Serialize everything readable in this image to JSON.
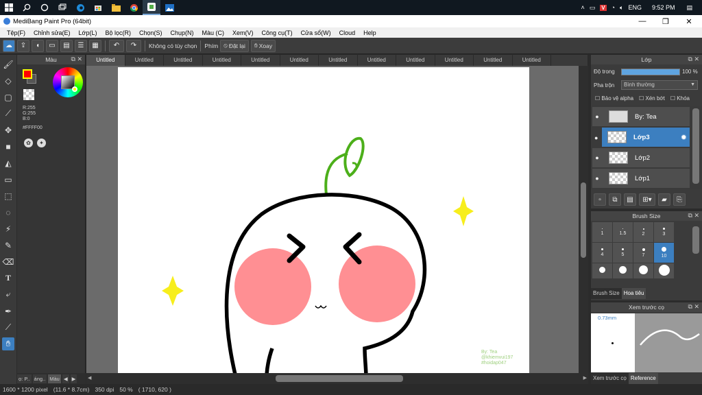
{
  "taskbar": {
    "icons": [
      "windows-icon",
      "search-icon",
      "cortana-icon",
      "task-view-icon",
      "edge-icon",
      "store-icon",
      "explorer-icon",
      "chrome-icon",
      "medibang-icon",
      "photos-icon"
    ],
    "tray": {
      "language": "ENG",
      "time": "9:52 PM"
    }
  },
  "window": {
    "title": "MediBang Paint Pro (64bit)"
  },
  "menu": [
    "Tệp(F)",
    "Chỉnh sửa(E)",
    "Lớp(L)",
    "Bộ lọc(R)",
    "Chọn(S)",
    "Chụp(N)",
    "Màu (C)",
    "Xem(V)",
    "Công cụ(T)",
    "Cửa sổ(W)",
    "Cloud",
    "Help"
  ],
  "toolbar": {
    "snap_label": "Không có tùy chọn",
    "key_label": "Phím",
    "reset_label": "Đặt lại",
    "rotate_label": "Xoay"
  },
  "color_panel": {
    "title": "Màu",
    "r": "R:255",
    "g": "G:255",
    "b": "B:0",
    "hex": "#FFFF00",
    "foreground": "#ff0000",
    "accent": "#ffff00"
  },
  "left_tabs": [
    "ọ: P..",
    "áng..",
    "Màu"
  ],
  "doc_tabs": [
    "Untitled",
    "Untitled",
    "Untitled",
    "Untitled",
    "Untitled",
    "Untitled",
    "Untitled",
    "Untitled",
    "Untitled",
    "Untitled",
    "Untitled",
    "Untitled"
  ],
  "canvas": {
    "watermark": [
      "By: Tea",
      "@khiemvui197",
      "#hoidap047"
    ]
  },
  "status": {
    "size": "1600 * 1200 pixel",
    "cm": "(11.6 * 8.7cm)",
    "dpi": "350 dpi",
    "zoom": "50 %",
    "coords": "( 1710, 620 )"
  },
  "layer_panel": {
    "title": "Lớp",
    "opacity_label": "Độ trong",
    "opacity_value": "100 %",
    "blend_label": "Pha trộn",
    "blend_value": "Bình thường",
    "protect_alpha": "Bảo vệ alpha",
    "clipping": "Xén bớt",
    "lock": "Khóa",
    "layers": [
      "By: Tea",
      "Lớp3",
      "Lớp2",
      "Lớp1"
    ],
    "selected_index": 1
  },
  "brush_panel": {
    "title": "Brush Size",
    "sizes": [
      "1",
      "1.5",
      "2",
      "3",
      "4",
      "5",
      "7",
      "10",
      "",
      "",
      "",
      ""
    ],
    "tabs": [
      "Brush Size",
      "Hoa tiêu"
    ]
  },
  "preview_panel": {
    "title": "Xem trước cọ",
    "size_label": "0.73mm",
    "tabs": [
      "Xem trước cọ",
      "Reference"
    ]
  },
  "colors": {
    "accent": "#3c7fc0",
    "cheek": "#ff8f93",
    "sparkle": "#f7ee1c",
    "sprout": "#4caf1a"
  }
}
